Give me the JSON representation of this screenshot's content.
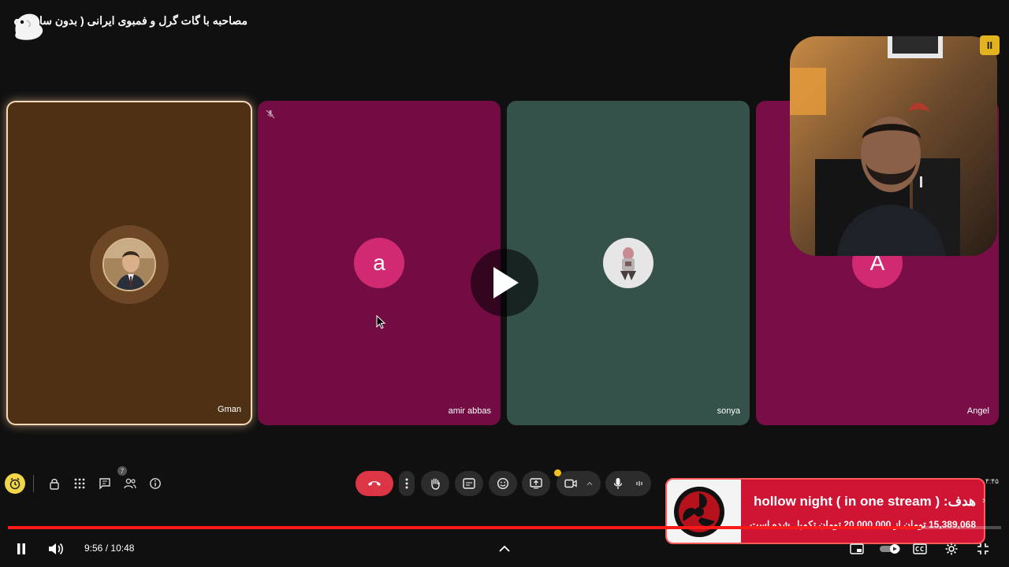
{
  "video": {
    "title": "مصاحبه با گات گرل و فمبوی ایرانی ( بدون سانسور )",
    "time_current": "9:56",
    "time_separator": "/",
    "time_total": "10:48",
    "progress_fraction": 0.92
  },
  "meet": {
    "participants": [
      {
        "name": "Gman",
        "avatar": "photo",
        "active_speaker": true
      },
      {
        "name": "amir abbas",
        "avatar_letter": "a",
        "muted": true
      },
      {
        "name": "sonya",
        "avatar": "photo"
      },
      {
        "name": "Angel",
        "avatar_letter": "A"
      }
    ],
    "flag_badge": "II",
    "participants_badge_count": "7"
  },
  "donation": {
    "line1": "هدف: ( hollow night ( in one stream",
    "line2": "15,389,068 تومان از 20,000,000 تومان تکمیل شده است.",
    "side_time": "۴:۴۵"
  },
  "colors": {
    "accent_red": "#ff1a1a",
    "end_call": "#dc3545",
    "gman_tile": "#4e3015",
    "amir_tile": "#720c43",
    "sonya_tile": "#34514a",
    "angel_tile": "#790d47",
    "timer_yellow": "#f2d64a"
  },
  "icons": [
    "ghost-icon",
    "timer-icon",
    "lock-icon",
    "apps-grid-icon",
    "chat-icon",
    "people-icon",
    "info-icon",
    "end-call-icon",
    "more-vert-icon",
    "raise-hand-icon",
    "captions-icon",
    "emoji-icon",
    "present-icon",
    "camera-icon",
    "chevron-up-icon",
    "mic-icon",
    "audio-level-icon",
    "play-icon",
    "pause-icon",
    "volume-icon",
    "miniplayer-icon",
    "autoplay-icon",
    "cc-icon",
    "settings-icon",
    "fullscreen-exit-icon"
  ]
}
